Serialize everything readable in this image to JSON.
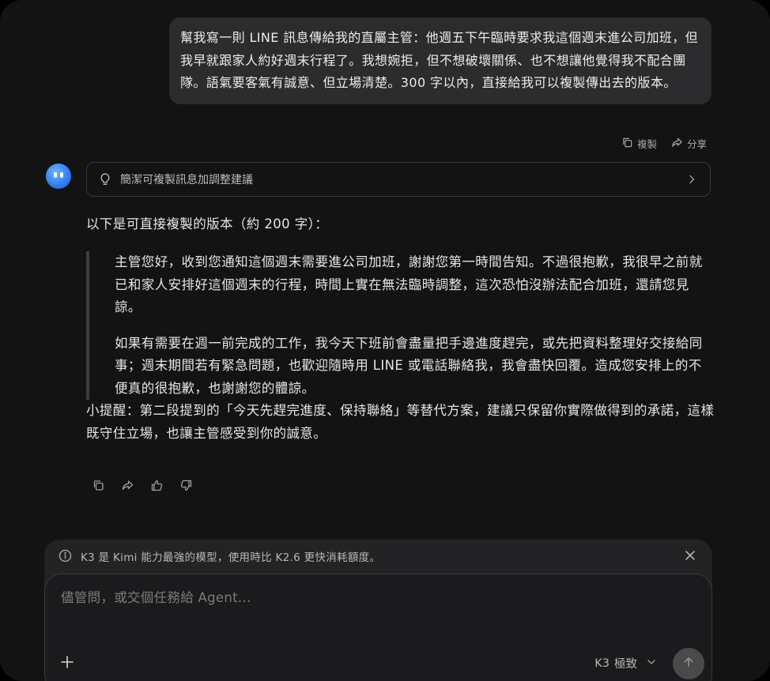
{
  "user_message": {
    "text": "幫我寫一則 LINE 訊息傳給我的直屬主管：他週五下午臨時要求我這個週末進公司加班，但我早就跟家人約好週末行程了。我想婉拒，但不想破壞關係、也不想讓他覺得我不配合團隊。語氣要客氣有誠意、但立場清楚。300 字以內，直接給我可以複製傳出去的版本。"
  },
  "message_actions": {
    "copy_label": "複製",
    "share_label": "分享"
  },
  "thinking": {
    "label": "簡潔可複製訊息加調整建議"
  },
  "answer": {
    "intro": "以下是可直接複製的版本（約 200 字）：",
    "quote_paragraphs": [
      "主管您好，收到您通知這個週末需要進公司加班，謝謝您第一時間告知。不過很抱歉，我很早之前就已和家人安排好這個週末的行程，時間上實在無法臨時調整，這次恐怕沒辦法配合加班，還請您見諒。",
      "如果有需要在週一前完成的工作，我今天下班前會盡量把手邊進度趕完，或先把資料整理好交接給同事；週末期間若有緊急問題，也歡迎隨時用 LINE 或電話聯絡我，我會盡快回覆。造成您安排上的不便真的很抱歉，也謝謝您的體諒。"
    ],
    "tip": "小提醒：第二段提到的「今天先趕完進度、保持聯絡」等替代方案，建議只保留你實際做得到的承諾，這樣既守住立場，也讓主管感受到你的誠意。"
  },
  "notice": {
    "text": "K3 是 Kimi 能力最強的模型，使用時比 K2.6 更快消耗額度。"
  },
  "composer": {
    "placeholder": "儘管問，或交個任務給 Agent...",
    "model_label": "K3",
    "mode_label": "極致"
  },
  "icons": {
    "copy": "copy-icon",
    "share": "share-icon",
    "bulb": "lightbulb-icon",
    "chevron": "chevron-right-icon",
    "regenerate": "regenerate-icon",
    "thumbs_up": "thumbs-up-icon",
    "thumbs_down": "thumbs-down-icon",
    "info": "info-icon",
    "close": "close-icon",
    "plus": "plus-icon",
    "send": "send-arrow-icon"
  },
  "colors": {
    "background": "#131313",
    "user_bubble": "#2c2c2e",
    "avatar_blue": "#2f7cf0"
  }
}
